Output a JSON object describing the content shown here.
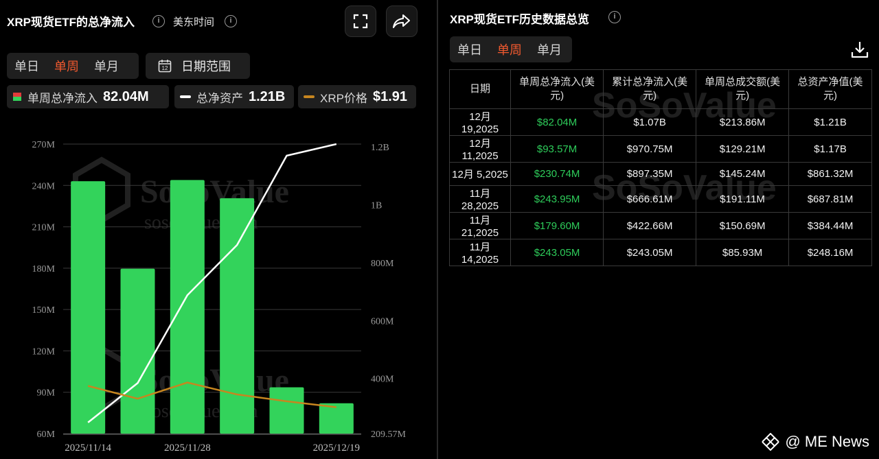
{
  "left": {
    "title": "XRP现货ETF的总净流入",
    "timezone": "美东时间",
    "period_tabs": [
      "单日",
      "单周",
      "单月"
    ],
    "active_period": "单周",
    "date_range_label": "日期范围",
    "legend": [
      {
        "name": "单周总净流入",
        "value": "82.04M"
      },
      {
        "name": "总净资产",
        "value": "1.21B"
      },
      {
        "name": "XRP价格",
        "value": "$1.91"
      }
    ]
  },
  "right": {
    "title": "XRP现货ETF历史数据总览",
    "period_tabs": [
      "单日",
      "单周",
      "单月"
    ],
    "active_period": "单周",
    "table": {
      "headers": [
        "日期",
        "单周总净流入(美元)",
        "累计总净流入(美元)",
        "单周总成交额(美元)",
        "总资产净值(美元)"
      ],
      "rows": [
        [
          "12月 19,2025",
          "$82.04M",
          "$1.07B",
          "$213.86M",
          "$1.21B"
        ],
        [
          "12月 11,2025",
          "$93.57M",
          "$970.75M",
          "$129.21M",
          "$1.17B"
        ],
        [
          "12月 5,2025",
          "$230.74M",
          "$897.35M",
          "$145.24M",
          "$861.32M"
        ],
        [
          "11月 28,2025",
          "$243.95M",
          "$666.61M",
          "$191.11M",
          "$687.81M"
        ],
        [
          "11月 21,2025",
          "$179.60M",
          "$422.66M",
          "$150.69M",
          "$384.44M"
        ],
        [
          "11月 14,2025",
          "$243.05M",
          "$243.05M",
          "$85.93M",
          "$248.16M"
        ]
      ]
    }
  },
  "watermark": "SoSoValue",
  "watermark_sub": "sosovalue.com",
  "brand": "@ ME News",
  "colors": {
    "bar": "#33d35b",
    "asset_line": "#ffffff",
    "price_line": "#c7861f",
    "active_tab": "#f0592f"
  },
  "chart_data": {
    "type": "bar",
    "categories": [
      "2025/11/14",
      "2025/11/21",
      "2025/11/28",
      "2025/12/5",
      "2025/12/11",
      "2025/12/19"
    ],
    "x_tick_labels": [
      "2025/11/14",
      "2025/11/28",
      "2025/12/19"
    ],
    "series": [
      {
        "name": "单周总净流入",
        "type": "bar",
        "axis": "left",
        "values": [
          243.05,
          179.6,
          243.95,
          230.74,
          93.57,
          82.04
        ]
      },
      {
        "name": "总净资产",
        "type": "line",
        "axis": "right",
        "values": [
          248.16,
          384.44,
          687.81,
          861.32,
          1170,
          1210
        ]
      },
      {
        "name": "XRP价格",
        "type": "line",
        "axis": "hidden",
        "values": [
          2.16,
          2.01,
          2.2,
          2.06,
          1.98,
          1.91
        ]
      }
    ],
    "y_left": {
      "min": 60,
      "max": 270,
      "ticks": [
        "60M",
        "90M",
        "120M",
        "150M",
        "180M",
        "210M",
        "240M",
        "270M"
      ]
    },
    "y_right": {
      "min": 209.57,
      "max": 1210,
      "ticks": [
        "209.57M",
        "400M",
        "600M",
        "800M",
        "1B",
        "1.2B"
      ]
    },
    "grid": true
  }
}
